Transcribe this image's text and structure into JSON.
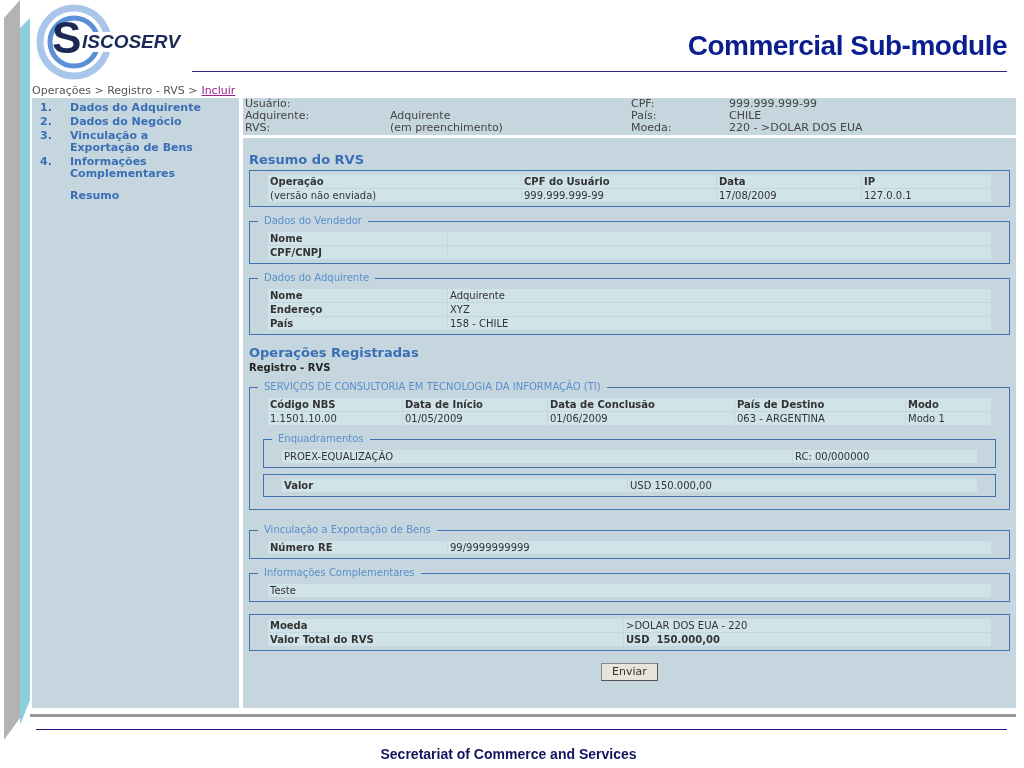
{
  "slide": {
    "title": "Commercial Sub-module",
    "footer": "Secretariat of Commerce and Services"
  },
  "logo": {
    "initial": "S",
    "text": "ISCOSERV"
  },
  "breadcrumb": {
    "path": "Operações > Registro - RVS >",
    "link": "Incluir"
  },
  "sidebar": {
    "items": [
      {
        "number": "1.",
        "label": "Dados do Adquirente"
      },
      {
        "number": "2.",
        "label": "Dados do Negócio"
      },
      {
        "number": "3.",
        "label": "Vinculação a Exportação de Bens"
      },
      {
        "number": "4.",
        "label": "Informações Complementares"
      },
      {
        "label": "Resumo"
      }
    ]
  },
  "header": {
    "left": [
      {
        "label": "Usuário:"
      },
      {
        "label": "Adquirente:",
        "value": "Adquirente"
      },
      {
        "label": "RVS:",
        "value": "(em preenchimento)"
      }
    ],
    "right": [
      {
        "label": "CPF:",
        "value": "999.999.999-99"
      },
      {
        "label": "País:",
        "value": "CHILE"
      },
      {
        "label": "Moeda:",
        "value": "220 - >DOLAR DOS EUA"
      }
    ]
  },
  "resumo": {
    "title": "Resumo do RVS",
    "columns": [
      "Operação",
      "CPF do Usuário",
      "Data",
      "IP"
    ],
    "row": [
      "(versão não enviada)",
      "999.999.999-99",
      "17/08/2009",
      "127.0.0.1"
    ]
  },
  "vendedor": {
    "legend": "Dados do Vendedor",
    "rows": [
      {
        "label": "Nome"
      },
      {
        "label": "CPF/CNPJ"
      }
    ]
  },
  "adquirente": {
    "legend": "Dados do Adquirente",
    "rows": [
      {
        "label": "Nome",
        "value": "Adquirente"
      },
      {
        "label": "Endereço",
        "value": "XYZ"
      },
      {
        "label": "País",
        "value": "158 - CHILE"
      }
    ]
  },
  "operacoes": {
    "title": "Operações Registradas",
    "subtitle": "Registro - RVS",
    "service": {
      "legend": "SERVIÇOS DE CONSULTORIA EM TECNOLOGIA DA INFORMAÇÃO (TI)",
      "columns": [
        "Código NBS",
        "Data de Início",
        "Data de Conclusão",
        "País de Destino",
        "Modo"
      ],
      "row": [
        "1.1501.10.00",
        "01/05/2009",
        "01/06/2009",
        "063 - ARGENTINA",
        "Modo 1"
      ],
      "enquadramentos": {
        "legend": "Enquadramentos",
        "name": "PROEX-EQUALIZAÇÃO",
        "rc": "RC: 00/000000"
      },
      "valor": {
        "label": "Valor",
        "value": "USD 150.000,00"
      }
    }
  },
  "vinculacao": {
    "legend": "Vinculação a Exportação de Bens",
    "rows": [
      {
        "label": "Número RE",
        "value": "99/9999999999"
      }
    ]
  },
  "informacoes": {
    "legend": "Informações Complementares",
    "text": "Teste"
  },
  "totais": {
    "rows": [
      {
        "label": "Moeda",
        "value": ">DOLAR DOS EUA - 220",
        "emphasis": false
      },
      {
        "label": "Valor Total do RVS",
        "value": "USD  150.000,00",
        "emphasis": true
      }
    ]
  },
  "submit": {
    "label": "Enviar"
  }
}
